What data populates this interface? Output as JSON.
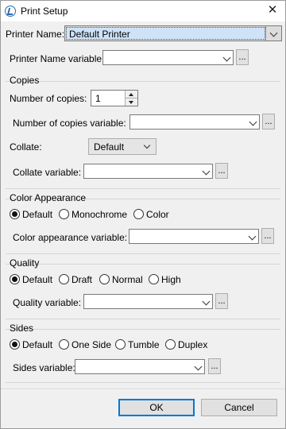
{
  "window": {
    "title": "Print Setup"
  },
  "printer": {
    "name_label": "Printer Name:",
    "name_value": "Default Printer",
    "variable_label": "Printer Name variable:",
    "variable_value": ""
  },
  "copies": {
    "group_label": "Copies",
    "number_label": "Number of copies:",
    "number_value": "1",
    "number_variable_label": "Number of copies variable:",
    "number_variable_value": "",
    "collate_label": "Collate:",
    "collate_value": "Default",
    "collate_variable_label": "Collate variable:",
    "collate_variable_value": ""
  },
  "color": {
    "group_label": "Color Appearance",
    "options": [
      "Default",
      "Monochrome",
      "Color"
    ],
    "selected": "Default",
    "variable_label": "Color appearance variable:",
    "variable_value": ""
  },
  "quality": {
    "group_label": "Quality",
    "options": [
      "Default",
      "Draft",
      "Normal",
      "High"
    ],
    "selected": "Default",
    "variable_label": "Quality variable:",
    "variable_value": ""
  },
  "sides": {
    "group_label": "Sides",
    "options": [
      "Default",
      "One Side",
      "Tumble",
      "Duplex"
    ],
    "selected": "Default",
    "variable_label": "Sides variable:",
    "variable_value": ""
  },
  "buttons": {
    "ok": "OK",
    "cancel": "Cancel",
    "browse": "..."
  },
  "icons": {
    "app": "app-logo-icon",
    "close": "close-icon"
  }
}
